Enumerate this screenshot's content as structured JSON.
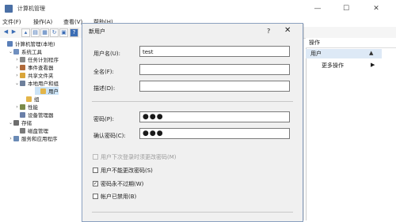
{
  "window": {
    "title": "计算机管理",
    "controls": [
      "—",
      "☐",
      "✕"
    ]
  },
  "menu": [
    "文件(F)",
    "操作(A)",
    "查看(V)",
    "帮助(H)"
  ],
  "tree": [
    {
      "label": "计算机管理(本地)",
      "indent": 0,
      "toggle": "",
      "icon": "computer-icon",
      "color": "#5a7fb8"
    },
    {
      "label": "系统工具",
      "indent": 1,
      "toggle": "⌄",
      "icon": "tools-icon",
      "color": "#6f8fbf"
    },
    {
      "label": "任务计划程序",
      "indent": 2,
      "toggle": "›",
      "icon": "clock-icon",
      "color": "#8a8a8a"
    },
    {
      "label": "事件查看器",
      "indent": 2,
      "toggle": "›",
      "icon": "event-icon",
      "color": "#b06a3a"
    },
    {
      "label": "共享文件夹",
      "indent": 2,
      "toggle": "›",
      "icon": "folder-icon",
      "color": "#d9a53a"
    },
    {
      "label": "本地用户和组",
      "indent": 2,
      "toggle": "⌄",
      "icon": "users-icon",
      "color": "#6d7f9b"
    },
    {
      "label": "用户",
      "indent": 3,
      "toggle": "",
      "icon": "folder-icon",
      "color": "#e3b54a",
      "selected": true
    },
    {
      "label": "组",
      "indent": 3,
      "toggle": "",
      "icon": "folder-icon",
      "color": "#e3b54a"
    },
    {
      "label": "性能",
      "indent": 2,
      "toggle": "›",
      "icon": "performance-icon",
      "color": "#7b8a4a"
    },
    {
      "label": "设备管理器",
      "indent": 2,
      "toggle": "",
      "icon": "device-icon",
      "color": "#6a7fa8"
    },
    {
      "label": "存储",
      "indent": 1,
      "toggle": "⌄",
      "icon": "storage-icon",
      "color": "#6d6d6d"
    },
    {
      "label": "磁盘管理",
      "indent": 2,
      "toggle": "",
      "icon": "disk-icon",
      "color": "#7a7a7a"
    },
    {
      "label": "服务和应用程序",
      "indent": 1,
      "toggle": "›",
      "icon": "services-icon",
      "color": "#6a8ab5"
    }
  ],
  "actions": {
    "header": "操作",
    "section": "用户",
    "more": "更多操作"
  },
  "dialog": {
    "title": "新用户",
    "help": "?",
    "close": "✕",
    "username_label": "用户名(U):",
    "username_value": "test",
    "fullname_label": "全名(F):",
    "fullname_value": "",
    "description_label": "描述(D):",
    "description_value": "",
    "password_label": "密码(P):",
    "password_value": "●●●",
    "confirm_label": "确认密码(C):",
    "confirm_value": "●●●",
    "checkboxes": [
      {
        "label": "用户下次登录时须更改密码(M)",
        "checked": false,
        "disabled": true
      },
      {
        "label": "用户不能更改密码(S)",
        "checked": false,
        "disabled": false
      },
      {
        "label": "密码永不过期(W)",
        "checked": true,
        "disabled": false
      },
      {
        "label": "帐户已禁用(B)",
        "checked": false,
        "disabled": false
      }
    ]
  }
}
